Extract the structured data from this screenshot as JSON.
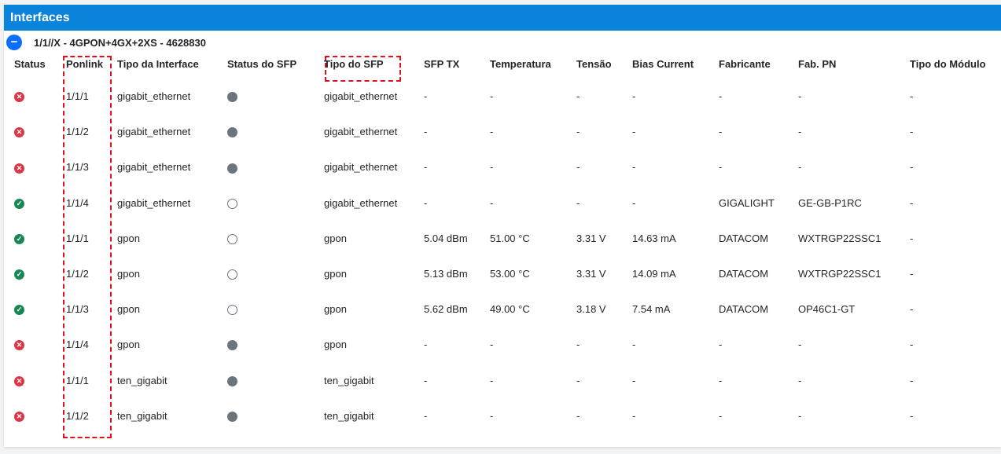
{
  "panel": {
    "title": "Interfaces",
    "group": {
      "toggle_label": "−",
      "title": "1/1//X - 4GPON+4GX+2XS - 4628830"
    }
  },
  "colors": {
    "header": "#0a84db",
    "status_up": "#198754",
    "status_down": "#dc3545",
    "sfp_dot": "#6c757d",
    "highlight": "#e0101c"
  },
  "table": {
    "headers": {
      "status": "Status",
      "ponlink": "Ponlink",
      "tipo_interface": "Tipo da Interface",
      "status_sfp": "Status do SFP",
      "tipo_sfp": "Tipo do SFP",
      "sfp_tx": "SFP TX",
      "temperatura": "Temperatura",
      "tensao": "Tensão",
      "bias": "Bias Current",
      "fabricante": "Fabricante",
      "fab_pn": "Fab. PN",
      "tipo_modulo": "Tipo do Módulo"
    },
    "rows": [
      {
        "status": "down",
        "status_icon": "x-circle-icon",
        "ponlink": "1/1/1",
        "tipo_interface": "gigabit_ethernet",
        "sfp_status": "filled",
        "tipo_sfp": "gigabit_ethernet",
        "sfp_tx": "-",
        "temperatura": "-",
        "tensao": "-",
        "bias": "-",
        "fabricante": "-",
        "fab_pn": "-",
        "tipo_modulo": "-"
      },
      {
        "status": "down",
        "status_icon": "x-circle-icon",
        "ponlink": "1/1/2",
        "tipo_interface": "gigabit_ethernet",
        "sfp_status": "filled",
        "tipo_sfp": "gigabit_ethernet",
        "sfp_tx": "-",
        "temperatura": "-",
        "tensao": "-",
        "bias": "-",
        "fabricante": "-",
        "fab_pn": "-",
        "tipo_modulo": "-"
      },
      {
        "status": "down",
        "status_icon": "x-circle-icon",
        "ponlink": "1/1/3",
        "tipo_interface": "gigabit_ethernet",
        "sfp_status": "filled",
        "tipo_sfp": "gigabit_ethernet",
        "sfp_tx": "-",
        "temperatura": "-",
        "tensao": "-",
        "bias": "-",
        "fabricante": "-",
        "fab_pn": "-",
        "tipo_modulo": "-"
      },
      {
        "status": "up",
        "status_icon": "check-circle-icon",
        "ponlink": "1/1/4",
        "tipo_interface": "gigabit_ethernet",
        "sfp_status": "empty",
        "tipo_sfp": "gigabit_ethernet",
        "sfp_tx": "-",
        "temperatura": "-",
        "tensao": "-",
        "bias": "-",
        "fabricante": "GIGALIGHT",
        "fab_pn": "GE-GB-P1RC",
        "tipo_modulo": "-"
      },
      {
        "status": "up",
        "status_icon": "check-circle-icon",
        "ponlink": "1/1/1",
        "tipo_interface": "gpon",
        "sfp_status": "empty",
        "tipo_sfp": "gpon",
        "sfp_tx": "5.04 dBm",
        "temperatura": "51.00 °C",
        "tensao": "3.31 V",
        "bias": "14.63 mA",
        "fabricante": "DATACOM",
        "fab_pn": "WXTRGP22SSC1",
        "tipo_modulo": "-"
      },
      {
        "status": "up",
        "status_icon": "check-circle-icon",
        "ponlink": "1/1/2",
        "tipo_interface": "gpon",
        "sfp_status": "empty",
        "tipo_sfp": "gpon",
        "sfp_tx": "5.13 dBm",
        "temperatura": "53.00 °C",
        "tensao": "3.31 V",
        "bias": "14.09 mA",
        "fabricante": "DATACOM",
        "fab_pn": "WXTRGP22SSC1",
        "tipo_modulo": "-"
      },
      {
        "status": "up",
        "status_icon": "check-circle-icon",
        "ponlink": "1/1/3",
        "tipo_interface": "gpon",
        "sfp_status": "empty",
        "tipo_sfp": "gpon",
        "sfp_tx": "5.62 dBm",
        "temperatura": "49.00 °C",
        "tensao": "3.18 V",
        "bias": "7.54 mA",
        "fabricante": "DATACOM",
        "fab_pn": "OP46C1-GT",
        "tipo_modulo": "-"
      },
      {
        "status": "down",
        "status_icon": "x-circle-icon",
        "ponlink": "1/1/4",
        "tipo_interface": "gpon",
        "sfp_status": "filled",
        "tipo_sfp": "gpon",
        "sfp_tx": "-",
        "temperatura": "-",
        "tensao": "-",
        "bias": "-",
        "fabricante": "-",
        "fab_pn": "-",
        "tipo_modulo": "-"
      },
      {
        "status": "down",
        "status_icon": "x-circle-icon",
        "ponlink": "1/1/1",
        "tipo_interface": "ten_gigabit",
        "sfp_status": "filled",
        "tipo_sfp": "ten_gigabit",
        "sfp_tx": "-",
        "temperatura": "-",
        "tensao": "-",
        "bias": "-",
        "fabricante": "-",
        "fab_pn": "-",
        "tipo_modulo": "-"
      },
      {
        "status": "down",
        "status_icon": "x-circle-icon",
        "ponlink": "1/1/2",
        "tipo_interface": "ten_gigabit",
        "sfp_status": "filled",
        "tipo_sfp": "ten_gigabit",
        "sfp_tx": "-",
        "temperatura": "-",
        "tensao": "-",
        "bias": "-",
        "fabricante": "-",
        "fab_pn": "-",
        "tipo_modulo": "-"
      }
    ]
  }
}
